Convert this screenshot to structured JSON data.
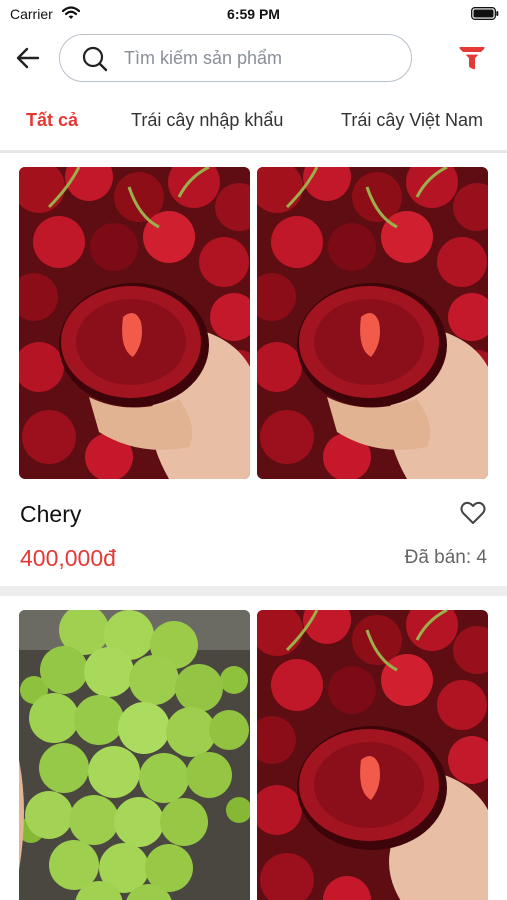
{
  "status_bar": {
    "carrier": "Carrier",
    "time": "6:59 PM",
    "icons": [
      "wifi-icon",
      "battery-icon"
    ]
  },
  "header": {
    "back_icon": "arrow-left-icon",
    "search_placeholder": "Tìm kiếm sản phẩm",
    "search_icon": "search-icon",
    "filter_icon": "filter-funnel-icon"
  },
  "tabs": [
    {
      "label": "Tất cả",
      "active": true
    },
    {
      "label": "Trái cây nhập khẩu",
      "active": false
    },
    {
      "label": "Trái cây Việt Nam",
      "active": false
    }
  ],
  "colors": {
    "accent": "#e53935",
    "muted_text": "#666666",
    "divider": "#e7e7e7"
  },
  "products": [
    {
      "name": "Chery",
      "price": "400,000đ",
      "sold": "Đã bán: 4",
      "images": [
        "cherry-photo",
        "cherry-photo"
      ],
      "favorite_icon": "heart-outline-icon"
    },
    {
      "images": [
        "green-grape-photo",
        "cherry-photo"
      ]
    }
  ]
}
